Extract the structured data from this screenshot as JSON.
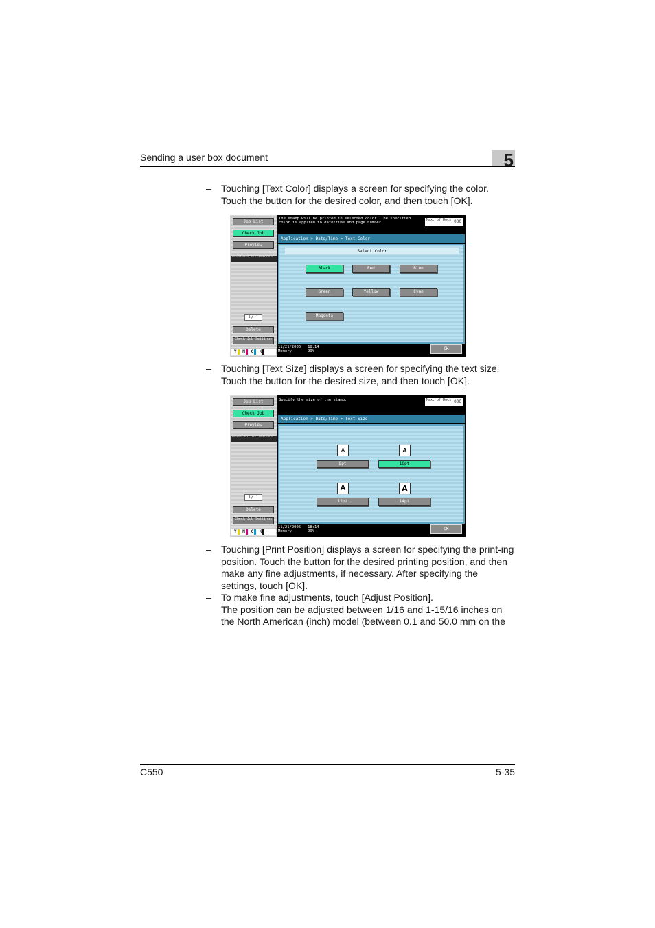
{
  "header": {
    "title": "Sending a user box document",
    "chapter": "5"
  },
  "footer": {
    "model": "C550",
    "page": "5-35"
  },
  "paragraphs": {
    "p1": "Touching [Text Color] displays a screen for specifying the color. Touch the button for the desired color, and then touch [OK].",
    "p2": "Touching [Text Size] displays a screen for specifying the text size. Touch the button for the desired size, and then touch [OK].",
    "p3": "Touching [Print Position] displays a screen for specifying the print-ing position. Touch the button for the desired printing position, and then make any fine adjustments, if necessary. After specifying the settings, touch [OK].",
    "p4": "To make fine adjustments, touch [Adjust Position].",
    "p4b": "The position can be adjusted between 1/16 and 1-15/16 inches on the North American (inch) model (between 0.1 and 50.0 mm on the",
    "dash": "–"
  },
  "sidebar": {
    "job_list": "Job List",
    "check_job": "Check Job",
    "preview": "Preview",
    "broadcast": "Broadcast Destinations",
    "page": "1/ 1",
    "delete": "Delete",
    "check_settings": "Check Job Settings",
    "toner": [
      "Y",
      "M",
      "C",
      "K"
    ]
  },
  "counter": {
    "label": "Max. of Docs.",
    "value": "000"
  },
  "status": {
    "date": "11/21/2006",
    "time": "18:14",
    "memory_label": "Memory",
    "memory": "99%"
  },
  "ok_label": "OK",
  "screen1": {
    "message": "The stamp will be printed in selected color. The specified color is applied to date/time and page number.",
    "breadcrumb": "Application > Date/Time > Text Color",
    "section": "Select Color",
    "colors": [
      "Black",
      "Red",
      "Blue",
      "Green",
      "Yellow",
      "Cyan",
      "Magenta"
    ]
  },
  "screen2": {
    "message": "Specify the size of the stamp.",
    "breadcrumb": "Application > Date/Time > Text Size",
    "sizes": [
      "8pt",
      "10pt",
      "12pt",
      "14pt"
    ],
    "sample": "A"
  }
}
